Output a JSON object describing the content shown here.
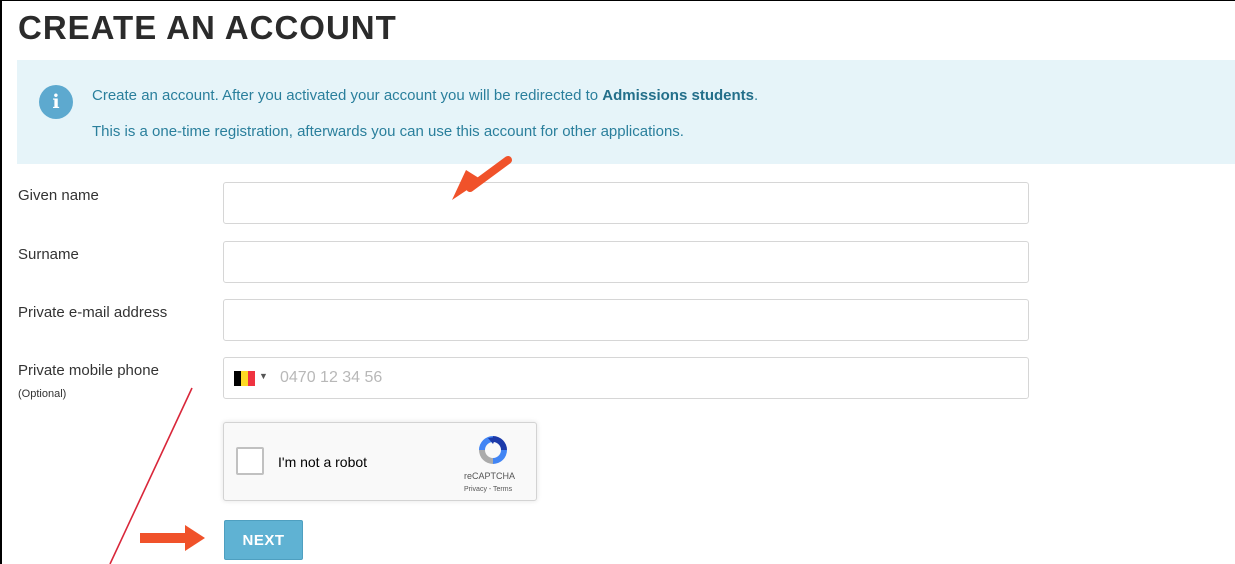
{
  "page": {
    "title": "CREATE AN ACCOUNT"
  },
  "info": {
    "icon": "info-icon",
    "line1_prefix": "Create an account. After you activated your account you will be redirected to ",
    "line1_strong": "Admissions students",
    "line1_suffix": ".",
    "line2": "This is a one-time registration, afterwards you can use this account for other applications.",
    "accent_color": "#2a7f9c",
    "background_color": "#e6f4f9"
  },
  "form": {
    "given_name": {
      "label": "Given name",
      "value": ""
    },
    "surname": {
      "label": "Surname",
      "value": ""
    },
    "email": {
      "label": "Private e-mail address",
      "value": ""
    },
    "phone": {
      "label": "Private mobile phone",
      "sublabel": "(Optional)",
      "country_flag": "belgium-flag",
      "placeholder": "0470 12 34 56",
      "value": ""
    }
  },
  "recaptcha": {
    "label": "I'm not a robot",
    "brand": "reCAPTCHA",
    "links": "Privacy - Terms",
    "checked": false
  },
  "actions": {
    "next_label": "NEXT",
    "button_color": "#5fb2d3"
  },
  "annotations": {
    "arrow_color": "#f0522a",
    "line_color": "#d9273a"
  }
}
